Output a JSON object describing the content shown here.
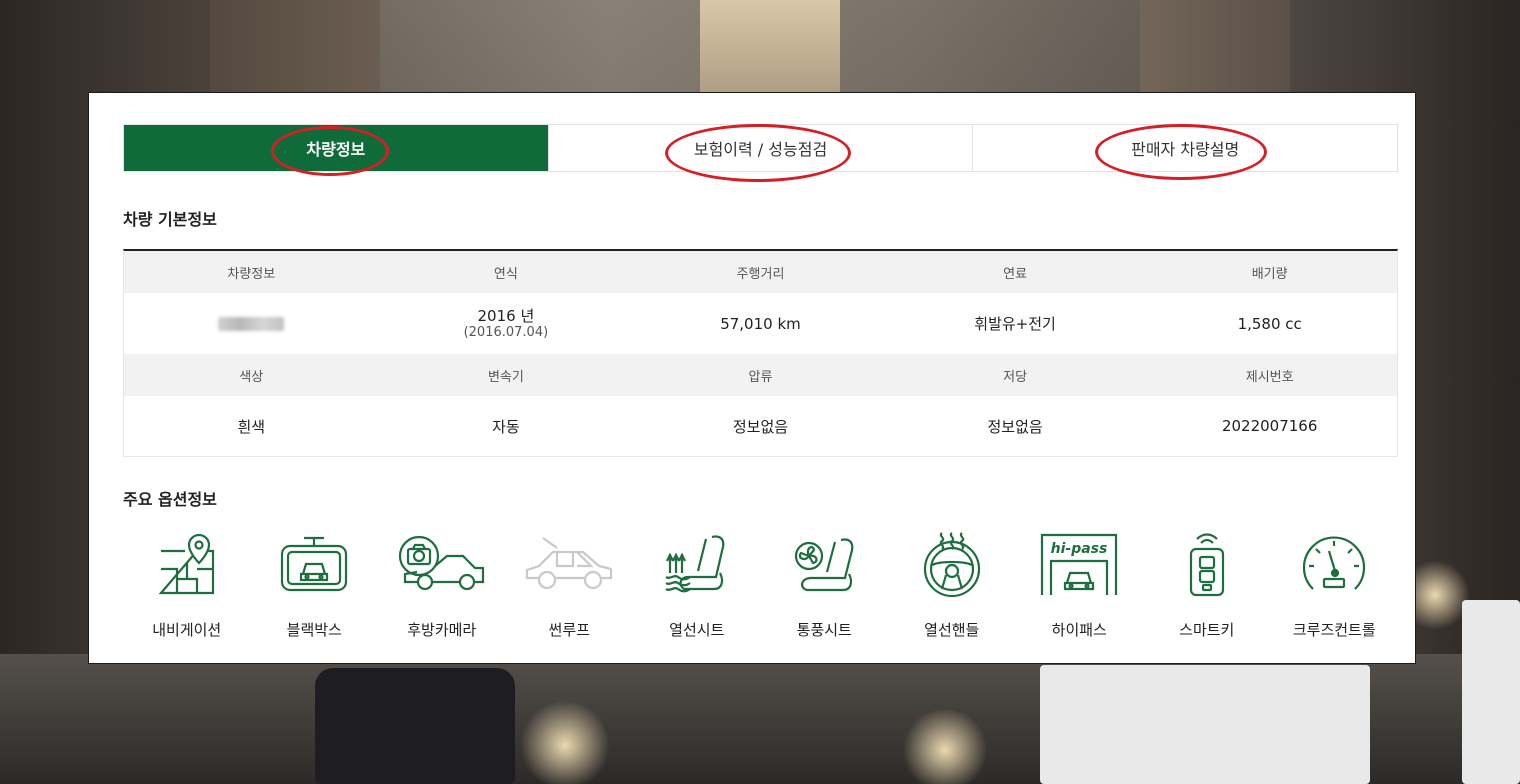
{
  "tabs": [
    {
      "label": "차량정보",
      "active": true
    },
    {
      "label": "보험이력 / 성능점검",
      "active": false
    },
    {
      "label": "판매자 차량설명",
      "active": false
    }
  ],
  "basic_info": {
    "title": "차량 기본정보",
    "row1_headers": [
      "차량정보",
      "연식",
      "주행거리",
      "연료",
      "배기량"
    ],
    "row1_values": {
      "vehicle_info": "",
      "year_main": "2016 년",
      "year_sub": "(2016.07.04)",
      "mileage": "57,010 km",
      "fuel": "휘발유+전기",
      "displacement": "1,580 cc"
    },
    "row2_headers": [
      "색상",
      "변속기",
      "압류",
      "저당",
      "제시번호"
    ],
    "row2_values": [
      "흰색",
      "자동",
      "정보없음",
      "정보없음",
      "2022007166"
    ]
  },
  "options": {
    "title": "주요 옵션정보",
    "items": [
      {
        "label": "내비게이션",
        "icon": "navigation-icon",
        "available": true
      },
      {
        "label": "블랙박스",
        "icon": "blackbox-icon",
        "available": true
      },
      {
        "label": "후방카메라",
        "icon": "rear-camera-icon",
        "available": true
      },
      {
        "label": "썬루프",
        "icon": "sunroof-icon",
        "available": false
      },
      {
        "label": "열선시트",
        "icon": "heated-seat-icon",
        "available": true
      },
      {
        "label": "통풍시트",
        "icon": "ventilated-seat-icon",
        "available": true
      },
      {
        "label": "열선핸들",
        "icon": "heated-steering-icon",
        "available": true
      },
      {
        "label": "하이패스",
        "icon": "hipass-icon",
        "available": true,
        "logo_text": "hi-pass"
      },
      {
        "label": "스마트키",
        "icon": "smart-key-icon",
        "available": true
      },
      {
        "label": "크루즈컨트롤",
        "icon": "cruise-control-icon",
        "available": true
      }
    ]
  },
  "colors": {
    "accent": "#0f6b3a",
    "highlight_ring": "#d41f26",
    "disabled_icon": "#c9c9c9"
  }
}
